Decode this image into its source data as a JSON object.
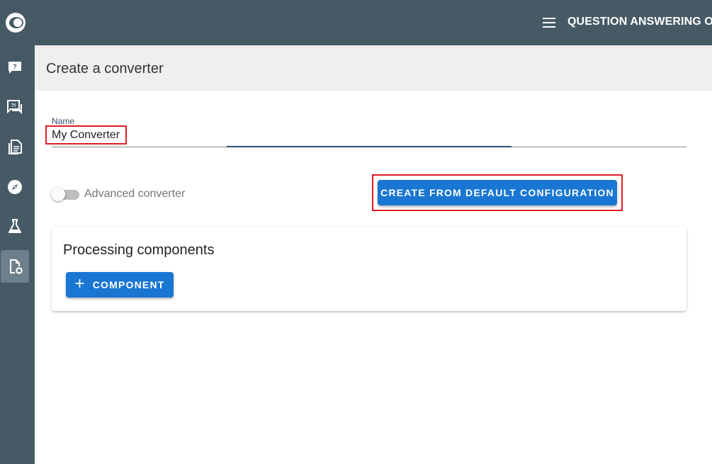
{
  "app": {
    "title": "QUESTION ANSWERING ON",
    "logo_icon": "eye-logo-icon"
  },
  "sidebar": {
    "items": [
      {
        "name": "feedback",
        "icon": "question-comment-icon",
        "active": false
      },
      {
        "name": "qa",
        "icon": "question-answer-icon",
        "active": false
      },
      {
        "name": "documents",
        "icon": "documents-icon",
        "active": false
      },
      {
        "name": "explore",
        "icon": "compass-icon",
        "active": false
      },
      {
        "name": "lab",
        "icon": "flask-icon",
        "active": false
      },
      {
        "name": "converters",
        "icon": "file-settings-icon",
        "active": true
      }
    ]
  },
  "page": {
    "title": "Create a converter"
  },
  "form": {
    "name_label": "Name",
    "name_value": "My Converter",
    "advanced_toggle_label": "Advanced converter",
    "advanced_toggle_on": false,
    "create_default_label": "CREATE FROM DEFAULT CONFIGURATION"
  },
  "processing": {
    "title": "Processing components",
    "add_component_label": "COMPONENT",
    "add_icon": "plus-icon"
  },
  "colors": {
    "sidebar_bg": "#465a66",
    "primary": "#1976d2",
    "highlight": "#e01b24",
    "header_band": "#efefef"
  }
}
